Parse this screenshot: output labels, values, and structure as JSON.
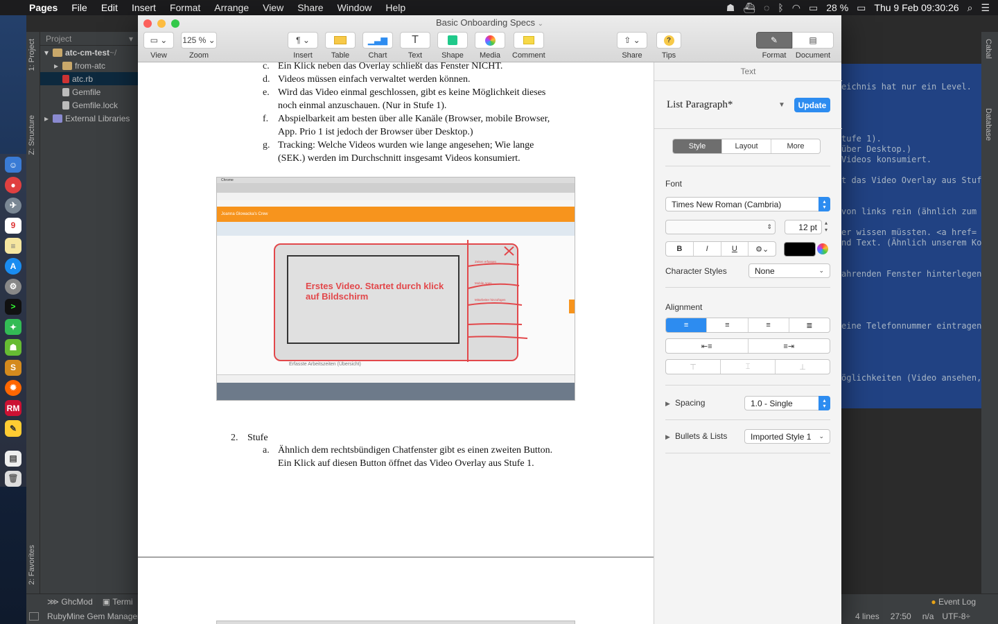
{
  "menubar": {
    "app_name": "Pages",
    "items": [
      "File",
      "Edit",
      "Insert",
      "Format",
      "Arrange",
      "View",
      "Share",
      "Window",
      "Help"
    ],
    "battery": "28 %",
    "clock": "Thu 9 Feb  09:30:26"
  },
  "ide": {
    "toolwindow_left_top": "1: Project",
    "toolwindow_left_mid": "Z: Structure",
    "toolwindow_left_bottom": "2: Favorites",
    "toolwindow_right_top": "Cabal",
    "toolwindow_right_mid": "Database",
    "project_header": "Project",
    "tree": [
      {
        "label": "atc-cm-test",
        "suffix": " ~/",
        "kind": "folder"
      },
      {
        "label": "from-atc",
        "kind": "folder"
      },
      {
        "label": "atc.rb",
        "kind": "ruby"
      },
      {
        "label": "Gemfile",
        "kind": "file"
      },
      {
        "label": "Gemfile.lock",
        "kind": "file"
      },
      {
        "label": "External Libraries",
        "kind": "lib"
      }
    ],
    "code_lines": [
      "eichnis hat nur ein Level.",
      "tufe 1).",
      " über Desktop.)",
      "Videos konsumiert.",
      "t das Video Overlay aus Stufe",
      " von links rein (ähnlich zum",
      "er wissen müssten. <a href= c",
      "nd Text. (Ähnlich unserem Kon",
      "ahrenden Fenster hinterlegen",
      "eine Telefonnummer eintragen",
      "öglichkeiten (Video ansehen, N"
    ],
    "bottom_tools": [
      "GhcMod",
      "Termi"
    ],
    "event_log": "Event Log",
    "status_left": "RubyMine Gem Manager",
    "status_right": [
      "4 lines",
      "27:50",
      "n/a",
      "UTF-8÷"
    ]
  },
  "window": {
    "title": "Basic Onboarding Specs"
  },
  "toolbar": {
    "view": "View",
    "zoom_value": "125 %",
    "zoom": "Zoom",
    "insert": "Insert",
    "table": "Table",
    "chart": "Chart",
    "text": "Text",
    "shape": "Shape",
    "media": "Media",
    "comment": "Comment",
    "share": "Share",
    "tips": "Tips",
    "format": "Format",
    "document": "Document"
  },
  "document": {
    "list_items": [
      {
        "marker": "c.",
        "lines": [
          "Ein Klick neben das Overlay schließt das Fenster NICHT."
        ]
      },
      {
        "marker": "d.",
        "lines": [
          "Videos müssen einfach verwaltet werden können."
        ]
      },
      {
        "marker": "e.",
        "lines": [
          "Wird das Video einmal geschlossen, gibt es keine Möglichkeit dieses",
          "noch einmal anzuschauen. (Nur in Stufe 1)."
        ]
      },
      {
        "marker": "f.",
        "lines": [
          "Abspielbarkeit am besten über alle Kanäle (Browser, mobile Browser,",
          "App. Prio 1 ist jedoch der Browser über Desktop.)"
        ]
      },
      {
        "marker": "g.",
        "lines": [
          "Tracking: Welche Videos wurden wie lange angesehen; Wie lange",
          "(SEK.) werden im Durchschnitt insgesamt Videos konsumiert."
        ]
      }
    ],
    "screenshot": {
      "browser_name": "Chrome",
      "company": "Joanna Glowacka's Crew",
      "sketch_text": "Erstes Video. Startet durch klick auf Bildschirm",
      "footer_text": "Erfasste Arbeitszeiten (Übersicht)",
      "side_notes": [
        "Zeiten erfassen",
        "Mobile Apps",
        "Mitarbeiter hinzufügen"
      ]
    },
    "section_number": "2.",
    "section_title": "Stufe",
    "section_item_marker": "a.",
    "section_item_lines": [
      "Ähnlich dem rechtsbündigen Chatfenster gibt es einen zweiten Button.",
      "Ein Klick auf diesen Button öffnet das Video Overlay aus Stufe 1."
    ]
  },
  "inspector": {
    "header": "Text",
    "paragraph_style": "List Paragraph*",
    "update_button": "Update",
    "tabs": [
      "Style",
      "Layout",
      "More"
    ],
    "font_label": "Font",
    "font_family": "Times New Roman (Cambria)",
    "font_size": "12 pt",
    "bold": "B",
    "italic": "I",
    "underline": "U",
    "character_styles_label": "Character Styles",
    "character_styles_value": "None",
    "alignment_label": "Alignment",
    "spacing_label": "Spacing",
    "spacing_value": "1.0 - Single",
    "bullets_label": "Bullets & Lists",
    "bullets_value": "Imported Style 1",
    "text_color": "#000000",
    "accent_color": "#2d8cf0"
  }
}
